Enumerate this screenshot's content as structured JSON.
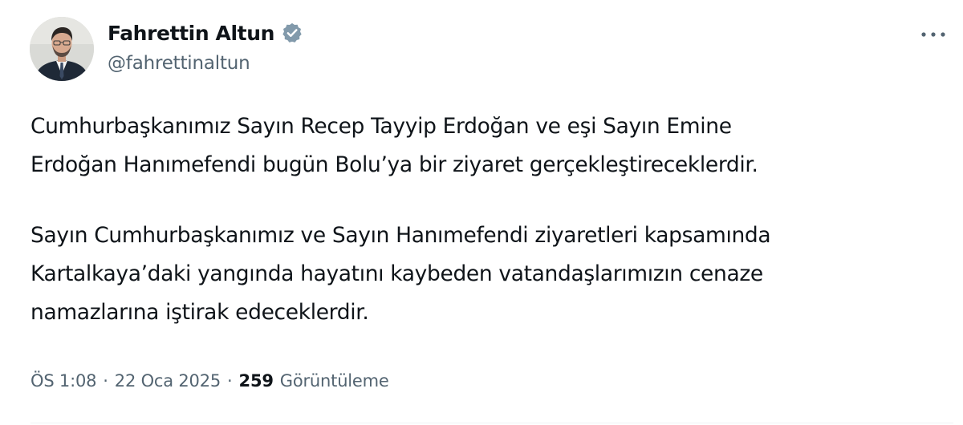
{
  "author": {
    "display_name": "Fahrettin Altun",
    "handle": "@fahrettinaltun",
    "verified": true,
    "verified_badge_color": "#829aab"
  },
  "icons": {
    "avatar": "profile-photo",
    "verified": "verified-badge-icon",
    "more": "more-horizontal-icon"
  },
  "tweet": {
    "paragraphs": [
      "Cumhurbaşkanımız Sayın Recep Tayyip Erdoğan ve eşi Sayın Emine\nErdoğan Hanımefendi bugün Bolu’ya bir ziyaret gerçekleştireceklerdir.",
      "Sayın Cumhurbaşkanımız ve Sayın Hanımefendi ziyaretleri kapsamında\nKartalkaya’daki yangında hayatını kaybeden vatandaşlarımızın cenaze\nnamazlarına iştirak edeceklerdir."
    ]
  },
  "meta": {
    "time": "ÖS 1:08",
    "separator": "·",
    "date": "22 Oca 2025",
    "views_count": "259",
    "views_label": "Görüntüleme"
  },
  "colors": {
    "text_primary": "#0f1419",
    "text_secondary": "#536471",
    "divider": "#eff3f4"
  }
}
